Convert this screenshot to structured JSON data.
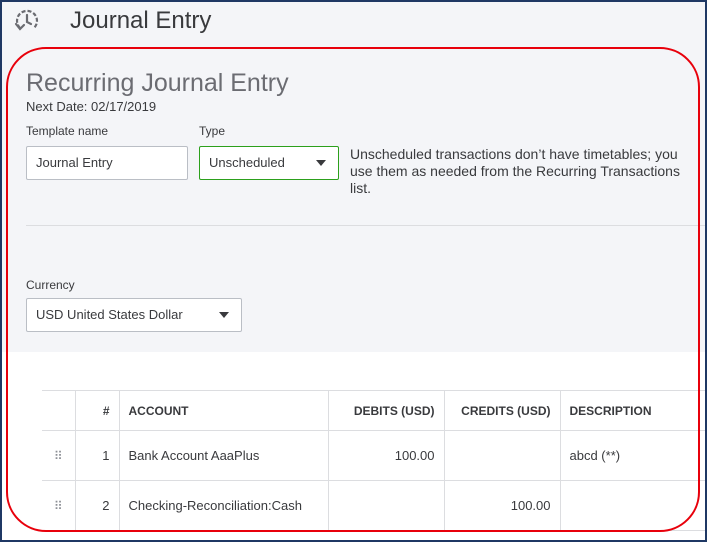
{
  "header": {
    "title": "Journal Entry",
    "icon": "recurring-clock-icon"
  },
  "form": {
    "section_title": "Recurring Journal Entry",
    "next_date": "Next Date: 02/17/2019",
    "template_name": {
      "label": "Template name",
      "value": "Journal Entry"
    },
    "type": {
      "label": "Type",
      "value": "Unscheduled"
    },
    "type_hint": "Unscheduled transactions don’t have timetables; you use them as needed from the Recurring Transactions list.",
    "currency": {
      "label": "Currency",
      "value": "USD United States Dollar"
    }
  },
  "table": {
    "columns": {
      "number": "#",
      "account": "ACCOUNT",
      "debits": "DEBITS (USD)",
      "credits": "CREDITS (USD)",
      "description": "DESCRIPTION"
    },
    "rows": [
      {
        "number": "1",
        "account": "Bank Account AaaPlus",
        "debits": "100.00",
        "credits": "",
        "description": "abcd (**)"
      },
      {
        "number": "2",
        "account": "Checking-Reconciliation:Cash",
        "debits": "",
        "credits": "100.00",
        "description": ""
      }
    ]
  },
  "colors": {
    "accent_green": "#2ca01c",
    "highlight_red": "#e8000b",
    "outer_frame": "#1f3864"
  }
}
